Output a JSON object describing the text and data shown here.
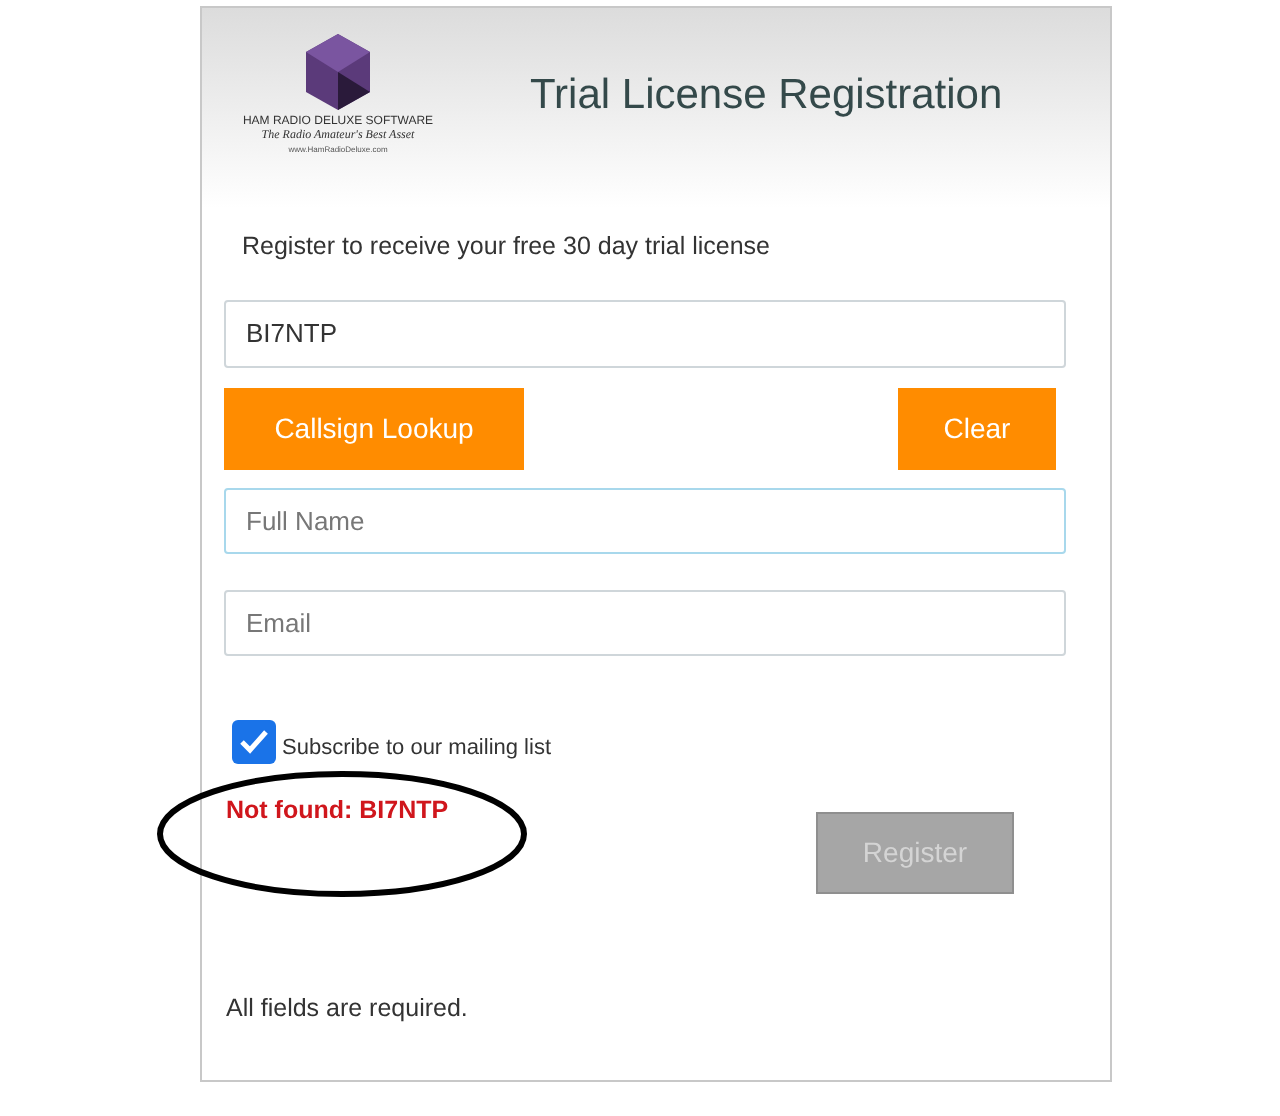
{
  "header": {
    "logo": {
      "line_1": "HAM RADIO DELUXE SOFTWARE",
      "line_2": "The Radio Amateur's Best Asset",
      "line_3": "www.HamRadioDeluxe.com"
    },
    "title": "Trial License Registration"
  },
  "intro": "Register to receive your free 30 day trial license",
  "callsign_field": {
    "value": "BI7NTP"
  },
  "buttons": [
    {
      "label": "Callsign Lookup"
    },
    {
      "label": "Clear"
    }
  ],
  "fields": [
    {
      "placeholder": "Full Name",
      "focused": true
    },
    {
      "placeholder": "Email",
      "focused": false
    }
  ],
  "subscribe": {
    "label": "Subscribe to our mailing list",
    "checked": true
  },
  "error": "Not found: BI7NTP",
  "register_button": {
    "label": "Register",
    "disabled": true
  },
  "footer": "All fields are required."
}
